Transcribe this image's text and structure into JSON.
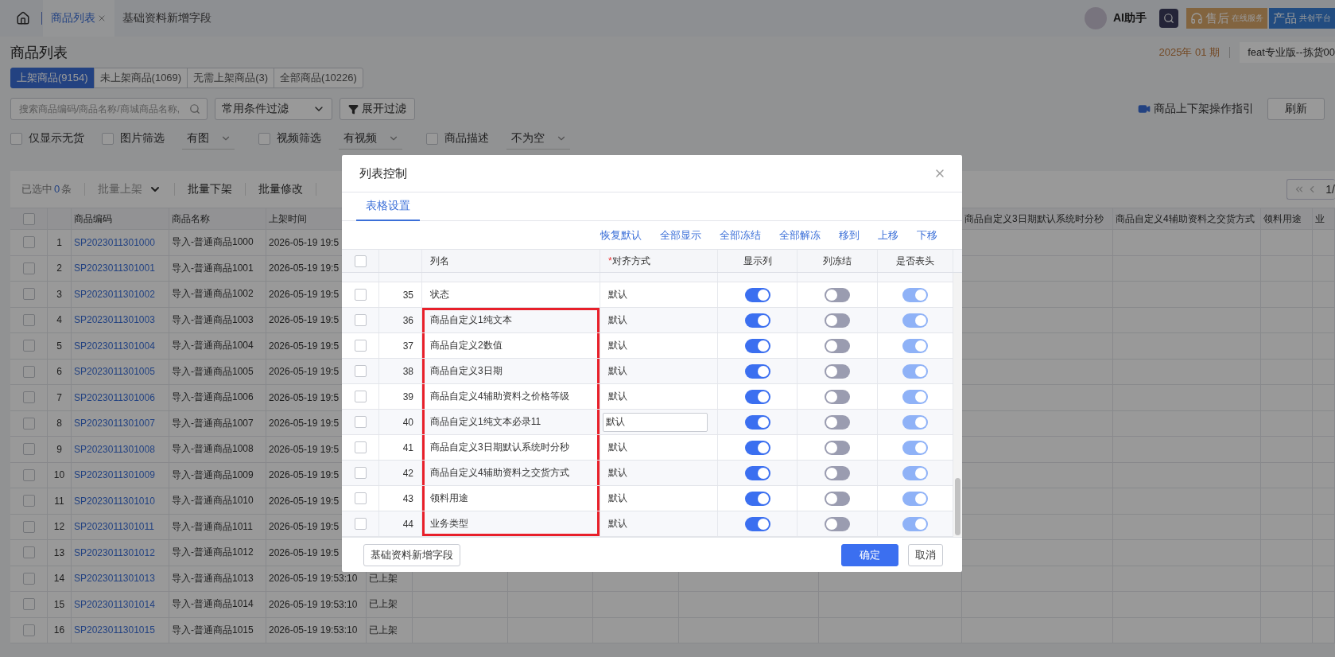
{
  "top_bar": {
    "tabs": [
      {
        "label": "商品列表",
        "selected": true,
        "closable": true
      },
      {
        "label": "基础资料新增字段",
        "selected": false,
        "closable": false
      }
    ],
    "assistant": "AI助手",
    "service_button": {
      "main": "售后",
      "sub": "在线服务"
    },
    "platform_button": {
      "main": "产品",
      "sub": "共创平台"
    }
  },
  "page": {
    "title": "商品列表",
    "period": "2025年 01 期",
    "edition": "feat专业版--拣货00"
  },
  "status_tabs": [
    {
      "label": "上架商品(9154)",
      "selected": true
    },
    {
      "label": "未上架商品(1069)",
      "selected": false
    },
    {
      "label": "无需上架商品(3)",
      "selected": false
    },
    {
      "label": "全部商品(10226)",
      "selected": false
    }
  ],
  "search": {
    "placeholder": "搜索商品编码/商品名称/商城商品名称,"
  },
  "condition_filter": "常用条件过滤",
  "expand_filter": "展开过滤",
  "guide_link": "商品上下架操作指引",
  "refresh": "刷新",
  "filters": [
    {
      "kind": "checkbox",
      "label": "仅显示无货",
      "checked": false
    },
    {
      "kind": "checkbox",
      "label": "图片筛选",
      "checked": false
    },
    {
      "kind": "select",
      "value": "有图"
    },
    {
      "kind": "checkbox",
      "label": "视频筛选",
      "checked": false
    },
    {
      "kind": "select",
      "value": "有视频"
    },
    {
      "kind": "checkbox",
      "label": "商品描述",
      "checked": false
    },
    {
      "kind": "select",
      "value": "不为空"
    }
  ],
  "toolbar": {
    "selected_prefix": "已选中",
    "selected_count": "0",
    "selected_suffix": "条",
    "actions": [
      {
        "label": "批量上架",
        "disabled": true,
        "dropdown": true
      },
      {
        "label": "批量下架",
        "disabled": false,
        "dropdown": false
      },
      {
        "label": "批量修改",
        "disabled": false,
        "dropdown": false
      }
    ]
  },
  "pagination": {
    "page": "1/"
  },
  "table": {
    "columns": [
      "商品编码",
      "商品名称",
      "上架时间"
    ],
    "right_columns": [
      "商品自定义3日期默认系统时分秒",
      "商品自定义4辅助资料之交货方式",
      "领料用途",
      "业"
    ],
    "header_checked": false,
    "rows": [
      {
        "index": "1",
        "code": "SP2023011301000",
        "name": "导入-普通商品1000",
        "time": "2026-05-19 19:5",
        "checked": false
      },
      {
        "index": "2",
        "code": "SP2023011301001",
        "name": "导入-普通商品1001",
        "time": "2026-05-19 19:5",
        "checked": false
      },
      {
        "index": "3",
        "code": "SP2023011301002",
        "name": "导入-普通商品1002",
        "time": "2026-05-19 19:5",
        "checked": false
      },
      {
        "index": "4",
        "code": "SP2023011301003",
        "name": "导入-普通商品1003",
        "time": "2026-05-19 19:5",
        "checked": false
      },
      {
        "index": "5",
        "code": "SP2023011301004",
        "name": "导入-普通商品1004",
        "time": "2026-05-19 19:5",
        "checked": false
      },
      {
        "index": "6",
        "code": "SP2023011301005",
        "name": "导入-普通商品1005",
        "time": "2026-05-19 19:5",
        "checked": false
      },
      {
        "index": "7",
        "code": "SP2023011301006",
        "name": "导入-普通商品1006",
        "time": "2026-05-19 19:5",
        "checked": false
      },
      {
        "index": "8",
        "code": "SP2023011301007",
        "name": "导入-普通商品1007",
        "time": "2026-05-19 19:5",
        "checked": false
      },
      {
        "index": "9",
        "code": "SP2023011301008",
        "name": "导入-普通商品1008",
        "time": "2026-05-19 19:5",
        "checked": false
      },
      {
        "index": "10",
        "code": "SP2023011301009",
        "name": "导入-普通商品1009",
        "time": "2026-05-19 19:5",
        "checked": false
      },
      {
        "index": "11",
        "code": "SP2023011301010",
        "name": "导入-普通商品1010",
        "time": "2026-05-19 19:5",
        "checked": false
      },
      {
        "index": "12",
        "code": "SP2023011301011",
        "name": "导入-普通商品1011",
        "time": "2026-05-19 19:5",
        "checked": false
      },
      {
        "index": "13",
        "code": "SP2023011301012",
        "name": "导入-普通商品1012",
        "time": "2026-05-19 19:5",
        "checked": false
      },
      {
        "index": "14",
        "code": "SP2023011301013",
        "name": "导入-普通商品1013",
        "time": "2026-05-19 19:53:10",
        "status": "已上架",
        "checked": false
      },
      {
        "index": "15",
        "code": "SP2023011301014",
        "name": "导入-普通商品1014",
        "time": "2026-05-19 19:53:10",
        "status": "已上架",
        "checked": false
      },
      {
        "index": "16",
        "code": "SP2023011301015",
        "name": "导入-普通商品1015",
        "time": "2026-05-19 19:53:10",
        "status": "已上架",
        "checked": false
      }
    ]
  },
  "dialog": {
    "title": "列表控制",
    "tabs": [
      {
        "label": "表格设置",
        "selected": true
      }
    ],
    "actions": [
      "恢复默认",
      "全部显示",
      "全部冻结",
      "全部解冻",
      "移到",
      "上移",
      "下移"
    ],
    "columns": [
      {
        "label": "列名"
      },
      {
        "label": "对齐方式",
        "mark": "*"
      },
      {
        "label": "显示列"
      },
      {
        "label": "列冻结"
      },
      {
        "label": "是否表头"
      }
    ],
    "header_checked": false,
    "rows": [
      {
        "index": "35",
        "name": "状态",
        "align": "默认",
        "editing": false,
        "highlighted": false,
        "checked": false,
        "show": true,
        "frozen": false,
        "header": true
      },
      {
        "index": "36",
        "name": "商品自定义1纯文本",
        "align": "默认",
        "editing": false,
        "highlighted": true,
        "checked": false,
        "show": true,
        "frozen": false,
        "header": true
      },
      {
        "index": "37",
        "name": "商品自定义2数值",
        "align": "默认",
        "editing": false,
        "highlighted": true,
        "checked": false,
        "show": true,
        "frozen": false,
        "header": true
      },
      {
        "index": "38",
        "name": "商品自定义3日期",
        "align": "默认",
        "editing": false,
        "highlighted": true,
        "checked": false,
        "show": true,
        "frozen": false,
        "header": true
      },
      {
        "index": "39",
        "name": "商品自定义4辅助资料之价格等级",
        "align": "默认",
        "editing": false,
        "highlighted": true,
        "checked": false,
        "show": true,
        "frozen": false,
        "header": true
      },
      {
        "index": "40",
        "name": "商品自定义1纯文本必录11",
        "align": "默认",
        "editing": true,
        "highlighted": true,
        "checked": false,
        "show": true,
        "frozen": false,
        "header": true
      },
      {
        "index": "41",
        "name": "商品自定义3日期默认系统时分秒",
        "align": "默认",
        "editing": false,
        "highlighted": true,
        "checked": false,
        "show": true,
        "frozen": false,
        "header": true
      },
      {
        "index": "42",
        "name": "商品自定义4辅助资料之交货方式",
        "align": "默认",
        "editing": false,
        "highlighted": true,
        "checked": false,
        "show": true,
        "frozen": false,
        "header": true
      },
      {
        "index": "43",
        "name": "领料用途",
        "align": "默认",
        "editing": false,
        "highlighted": true,
        "checked": false,
        "show": true,
        "frozen": false,
        "header": true
      },
      {
        "index": "44",
        "name": "业务类型",
        "align": "默认",
        "editing": false,
        "highlighted": true,
        "checked": false,
        "show": true,
        "frozen": false,
        "header": true
      }
    ],
    "footer": {
      "extra_button": "基础资料新增字段",
      "confirm": "确定",
      "cancel": "取消"
    }
  }
}
